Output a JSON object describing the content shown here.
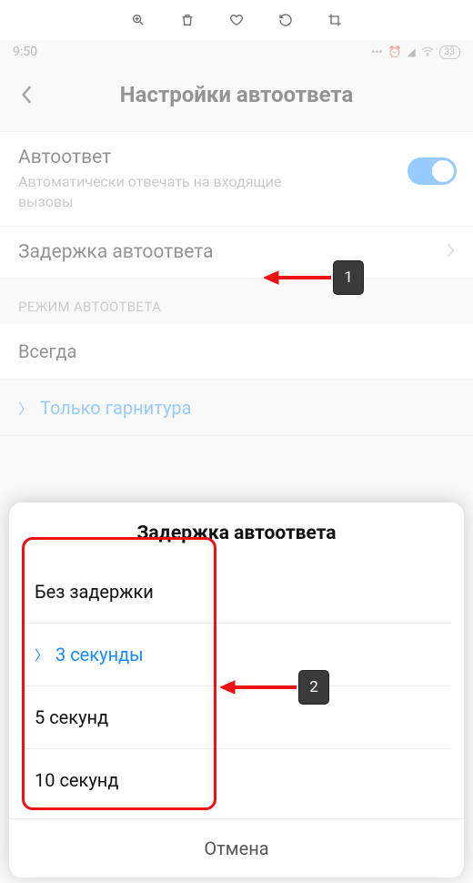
{
  "statusbar": {
    "time": "9:50",
    "battery": "33"
  },
  "header": {
    "title": "Настройки автоответа"
  },
  "autoanswer": {
    "title": "Автоответ",
    "subtitle": "Автоматически отвечать на входящие вызовы"
  },
  "delay": {
    "title": "Задержка автоответа"
  },
  "section_mode": "РЕЖИМ АВТООТВЕТА",
  "mode_always": "Всегда",
  "mode_headset": "Только гарнитура",
  "sheet": {
    "title": "Задержка автоответа",
    "options": [
      "Без задержки",
      "3 секунды",
      "5 секунд",
      "10 секунд"
    ],
    "cancel": "Отмена"
  },
  "annotations": {
    "one": "1",
    "two": "2"
  }
}
